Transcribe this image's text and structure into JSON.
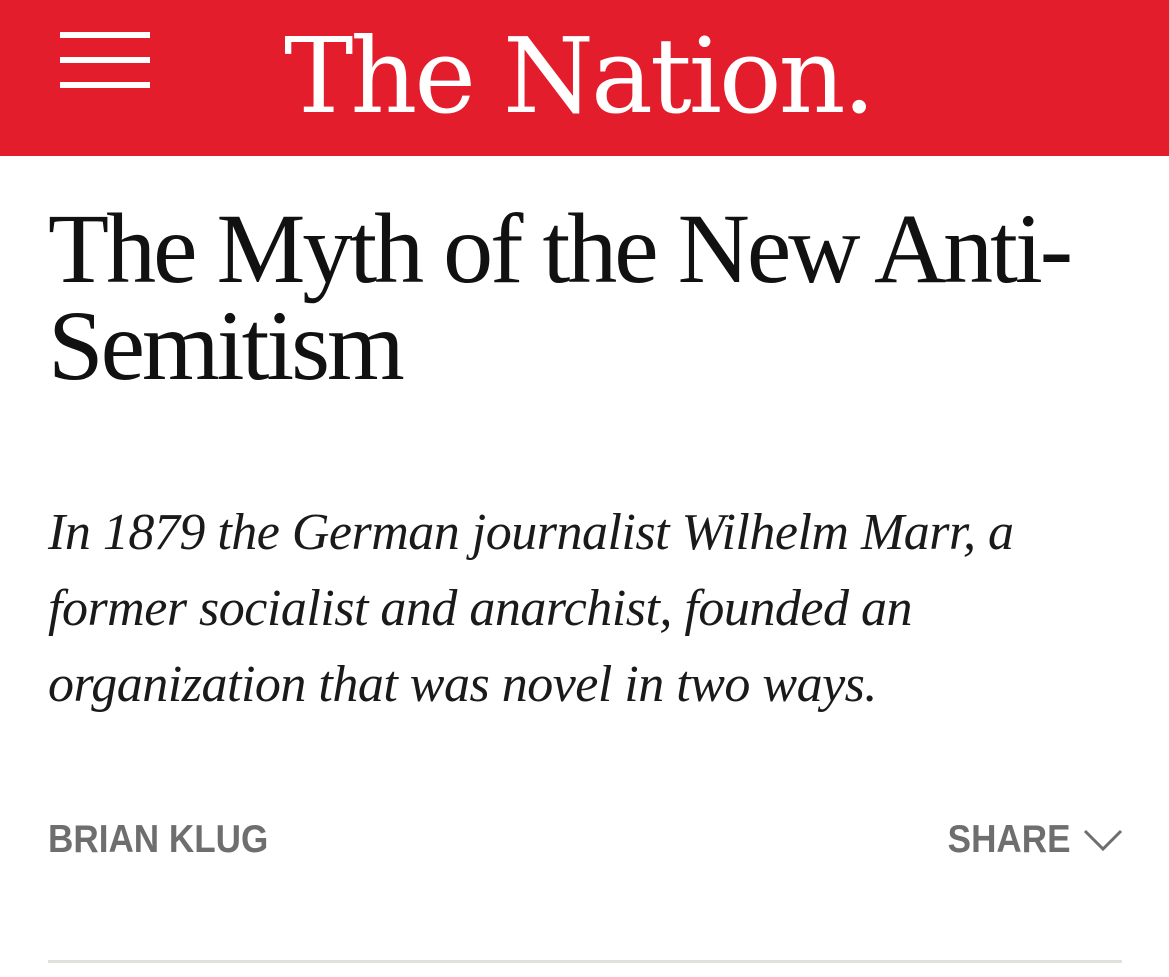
{
  "header": {
    "brand": "The Nation.",
    "menu_icon": "hamburger-menu-icon",
    "background_color": "#e41d2d"
  },
  "article": {
    "title": "The Myth of the New Anti-Semitism",
    "dek": "In 1879 the German journalist Wilhelm Marr, a former socialist and anarchist, founded an organization that was novel in two ways.",
    "author": "BRIAN KLUG",
    "share_label": "SHARE",
    "share_icon": "chevron-down-icon"
  }
}
